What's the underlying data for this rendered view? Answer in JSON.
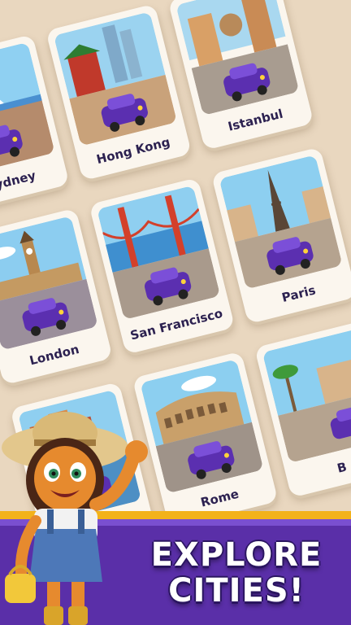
{
  "cities": [
    {
      "id": "sydney",
      "label": "Sydney"
    },
    {
      "id": "hong-kong",
      "label": "Hong Kong"
    },
    {
      "id": "istanbul",
      "label": "Istanbul"
    },
    {
      "id": "london",
      "label": "London"
    },
    {
      "id": "san-francisco",
      "label": "San Francisco"
    },
    {
      "id": "paris",
      "label": "Paris"
    },
    {
      "id": "rome",
      "label": "Rome"
    },
    {
      "id": "amsterdam",
      "label": ""
    },
    {
      "id": "barcelona",
      "label": "B"
    }
  ],
  "headline": {
    "line1": "EXPLORE",
    "line2": "CITIES!"
  },
  "colors": {
    "banner": "#5a2fa8",
    "banner_trim": "#f3b21a",
    "card_bg": "#fbf6ee",
    "label_text": "#2c2150",
    "car": "#5b2fb0"
  },
  "icons": [
    "car-icon",
    "mascot-girl"
  ]
}
